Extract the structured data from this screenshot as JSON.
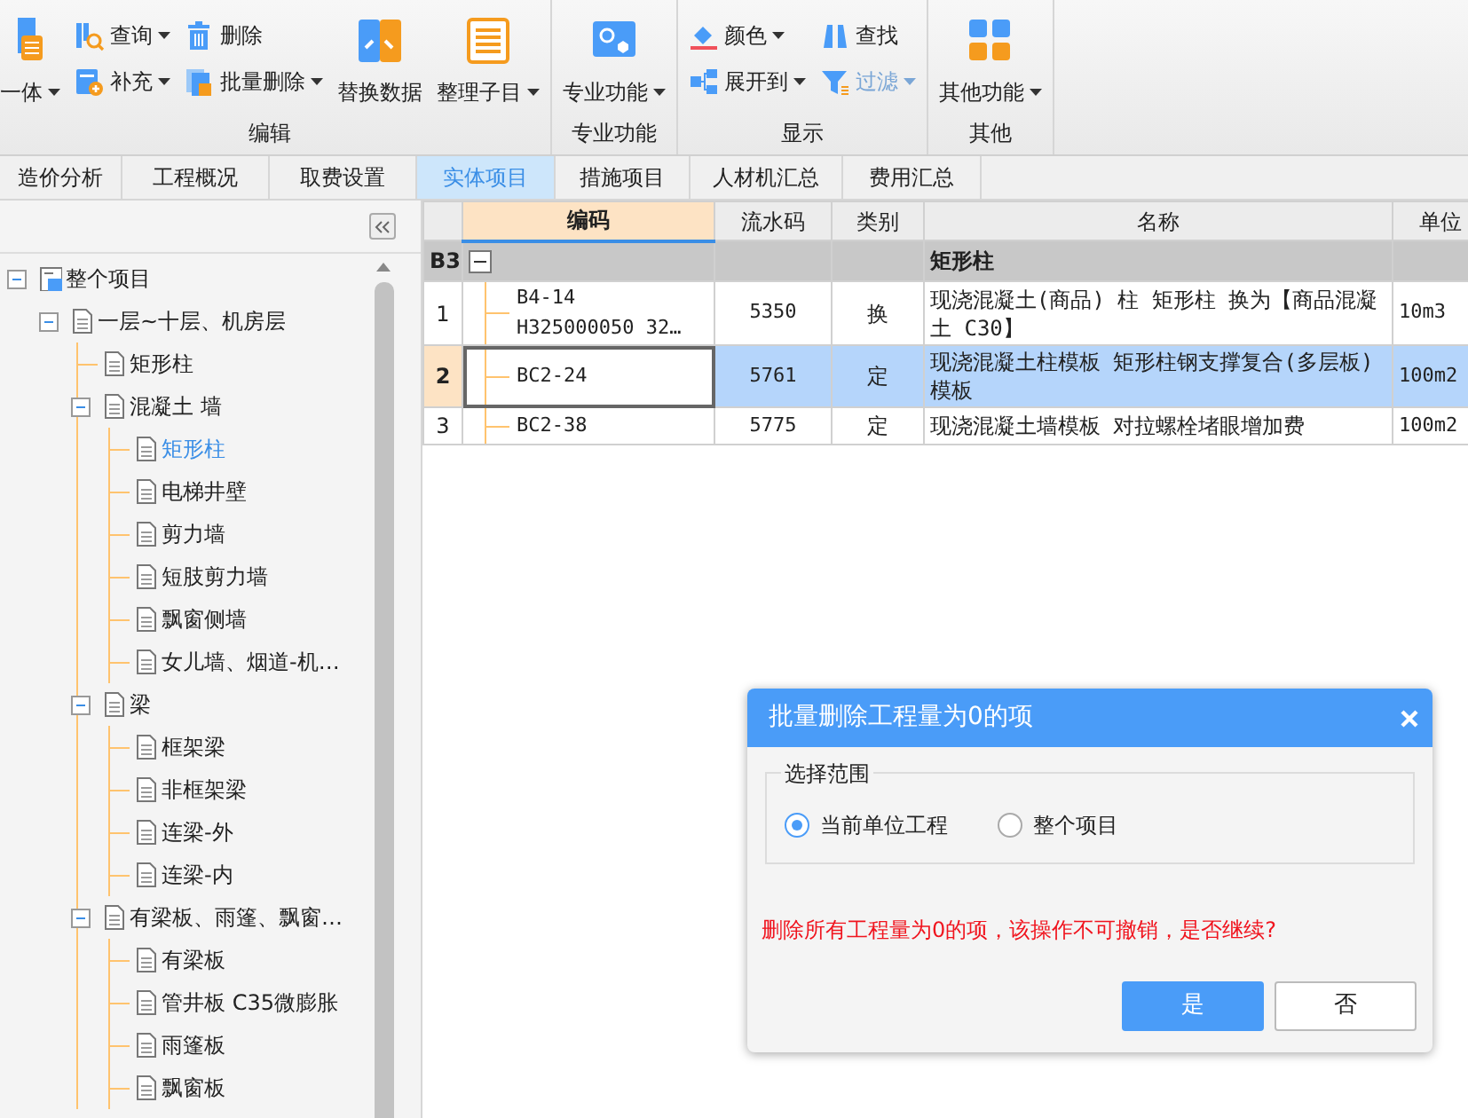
{
  "ribbon": {
    "groups": [
      {
        "label": "编辑",
        "columns": [
          {
            "kind": "large",
            "items": [
              {
                "label": "一体",
                "dropdown": true
              }
            ]
          },
          {
            "kind": "small",
            "items": [
              {
                "label": "查询",
                "dropdown": true
              },
              {
                "label": "补充",
                "dropdown": true
              }
            ]
          },
          {
            "kind": "small",
            "items": [
              {
                "label": "删除",
                "dropdown": false
              },
              {
                "label": "批量删除",
                "dropdown": true
              }
            ]
          },
          {
            "kind": "large",
            "items": [
              {
                "label": "替换数据",
                "dropdown": false
              }
            ]
          },
          {
            "kind": "large",
            "items": [
              {
                "label": "整理子目",
                "dropdown": true
              }
            ]
          }
        ]
      },
      {
        "label": "专业功能",
        "columns": [
          {
            "kind": "large",
            "items": [
              {
                "label": "专业功能",
                "dropdown": true
              }
            ]
          }
        ]
      },
      {
        "label": "显示",
        "columns": [
          {
            "kind": "small",
            "items": [
              {
                "label": "颜色",
                "dropdown": true
              },
              {
                "label": "展开到",
                "dropdown": true
              }
            ]
          },
          {
            "kind": "small",
            "items": [
              {
                "label": "查找",
                "dropdown": false
              },
              {
                "label": "过滤",
                "dropdown": true,
                "disabled": true
              }
            ]
          }
        ]
      },
      {
        "label": "其他",
        "columns": [
          {
            "kind": "large",
            "items": [
              {
                "label": "其他功能",
                "dropdown": true
              }
            ]
          }
        ]
      }
    ]
  },
  "tabs": [
    {
      "label": "造价分析",
      "selected": false
    },
    {
      "label": "工程概况",
      "selected": false
    },
    {
      "label": "取费设置",
      "selected": false
    },
    {
      "label": "实体项目",
      "selected": true
    },
    {
      "label": "措施项目",
      "selected": false
    },
    {
      "label": "人材机汇总",
      "selected": false
    },
    {
      "label": "费用汇总",
      "selected": false
    }
  ],
  "tree": [
    {
      "label": "整个项目",
      "kind": "project",
      "expanded": true,
      "selected": false,
      "children": [
        {
          "label": "一层~十层、机房层",
          "expanded": true,
          "selected": false,
          "children": [
            {
              "label": "矩形柱",
              "selected": false
            },
            {
              "label": "混凝土 墙",
              "expanded": true,
              "selected": false,
              "children": [
                {
                  "label": "矩形柱",
                  "selected": true
                },
                {
                  "label": "电梯井壁",
                  "selected": false
                },
                {
                  "label": "剪力墙",
                  "selected": false
                },
                {
                  "label": "短肢剪力墙",
                  "selected": false
                },
                {
                  "label": "飘窗侧墙",
                  "selected": false
                },
                {
                  "label": "女儿墙、烟道-机…",
                  "selected": false
                }
              ]
            },
            {
              "label": "梁",
              "expanded": true,
              "selected": false,
              "children": [
                {
                  "label": "框架梁",
                  "selected": false
                },
                {
                  "label": "非框架梁",
                  "selected": false
                },
                {
                  "label": "连梁-外",
                  "selected": false
                },
                {
                  "label": "连梁-内",
                  "selected": false
                }
              ]
            },
            {
              "label": "有梁板、雨篷、飘窗…",
              "expanded": true,
              "selected": false,
              "children": [
                {
                  "label": "有梁板",
                  "selected": false
                },
                {
                  "label": "管井板 C35微膨胀",
                  "selected": false
                },
                {
                  "label": "雨篷板",
                  "selected": false
                },
                {
                  "label": "飘窗板",
                  "selected": false
                }
              ]
            }
          ]
        }
      ]
    }
  ],
  "table": {
    "columns": [
      "编码",
      "流水码",
      "类别",
      "名称",
      "单位"
    ],
    "rows": [
      {
        "kind": "group",
        "row_header": "B3",
        "expanded": true,
        "name": "矩形柱",
        "selected": false
      },
      {
        "kind": "item",
        "row_header": "1",
        "code": "B4-14\nH325000050 32…",
        "serial": "5350",
        "category": "换",
        "name": "现浇混凝土(商品) 柱 矩形柱  换为【商品混凝土 C30】",
        "unit": "10m3",
        "selected": false
      },
      {
        "kind": "item",
        "row_header": "2",
        "code": "BC2-24",
        "serial": "5761",
        "category": "定",
        "name": "现浇混凝土柱模板 矩形柱钢支撑复合(多层板)模板",
        "unit": "100m2",
        "selected": true
      },
      {
        "kind": "item",
        "row_header": "3",
        "code": "BC2-38",
        "serial": "5775",
        "category": "定",
        "name": "现浇混凝土墙模板 对拉螺栓堵眼增加费",
        "unit": "100m2",
        "selected": false
      }
    ]
  },
  "dialog": {
    "title": "批量删除工程量为0的项",
    "fieldset_label": "选择范围",
    "options": [
      {
        "label": "当前单位工程",
        "selected": true
      },
      {
        "label": "整个项目",
        "selected": false
      }
    ],
    "warning": "删除所有工程量为0的项，该操作不可撤销，是否继续?",
    "buttons": [
      {
        "label": "是",
        "kind": "primary"
      },
      {
        "label": "否",
        "kind": "secondary"
      }
    ]
  }
}
